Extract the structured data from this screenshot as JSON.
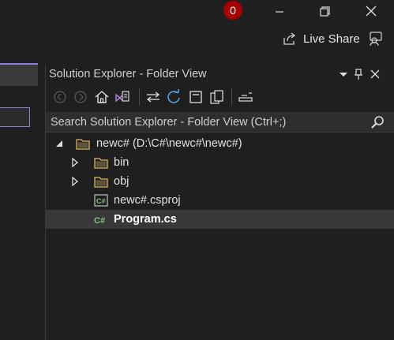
{
  "titlebar": {
    "notification_count": "0"
  },
  "toolbar": {
    "live_share_label": "Live Share"
  },
  "solution_explorer": {
    "title": "Solution Explorer - Folder View",
    "search_placeholder": "Search Solution Explorer - Folder View (Ctrl+;)",
    "tree": [
      {
        "label": "newc# (D:\\C#\\newc#\\newc#)",
        "type": "folder",
        "expanded": true
      },
      {
        "label": "bin",
        "type": "folder",
        "expanded": false
      },
      {
        "label": "obj",
        "type": "folder",
        "expanded": false
      },
      {
        "label": "newc#.csproj",
        "type": "csproj"
      },
      {
        "label": "Program.cs",
        "type": "csfile",
        "selected": true
      }
    ]
  },
  "colors": {
    "background": "#1f1f1f",
    "selection": "#383838",
    "accent": "#8a7ed6",
    "badge": "#a80000",
    "folder": "#d9b66a",
    "csharp": "#7fc77f"
  }
}
